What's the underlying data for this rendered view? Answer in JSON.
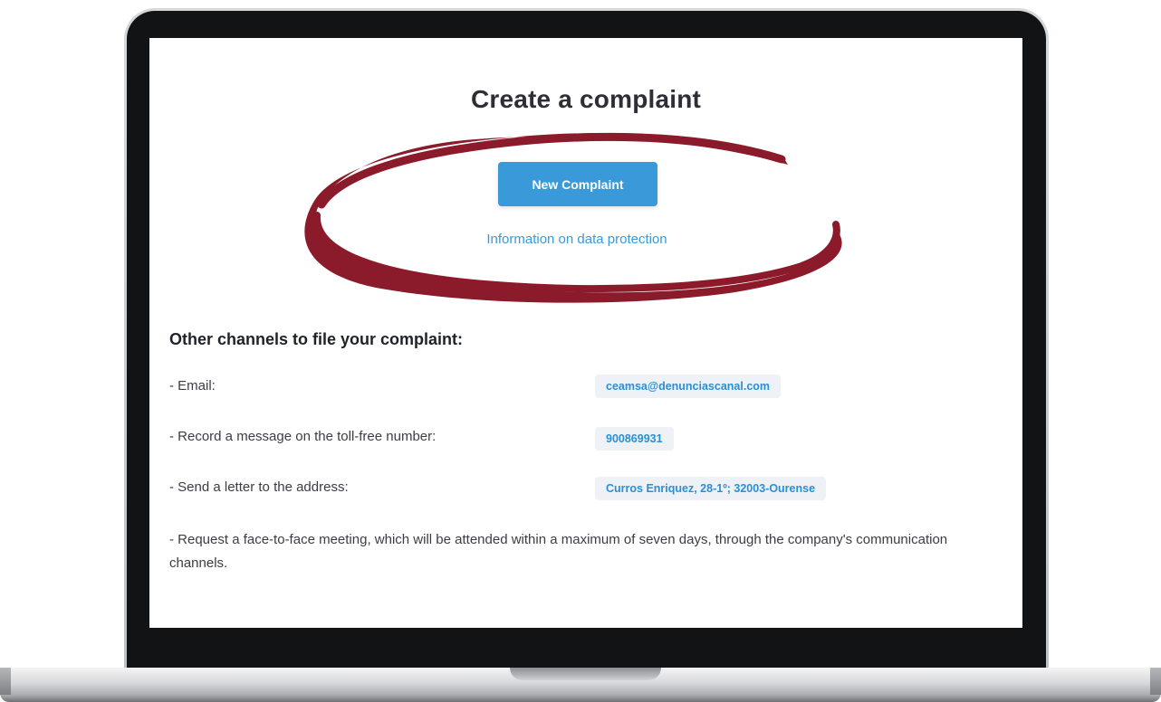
{
  "page": {
    "title": "Create a complaint",
    "new_complaint_button": "New Complaint",
    "data_protection_link": "Information on data protection"
  },
  "channels": {
    "heading": "Other channels to file your complaint:",
    "email_label": "- Email:",
    "email_value": "ceamsa@denunciascanal.com",
    "phone_label": "- Record a message on the toll-free number:",
    "phone_value": "900869931",
    "address_label": "- Send a letter to the address:",
    "address_value": "Curros Enriquez, 28-1º; 32003-Ourense",
    "meeting_text": "- Request a face-to-face meeting, which will be attended within a maximum of seven days, through the company's communication channels."
  },
  "colors": {
    "accent": "#3a9ad9",
    "highlight_ring": "#8b1a2b",
    "chip_bg": "#eef1f5"
  },
  "icons": {
    "highlight": "hand-drawn-ellipse"
  }
}
